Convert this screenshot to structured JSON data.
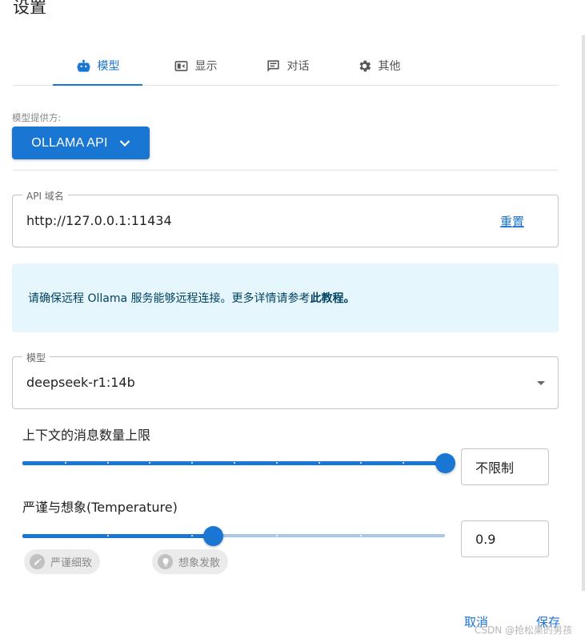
{
  "dialog": {
    "title": "设置"
  },
  "tabs": [
    {
      "label": "模型",
      "icon": "robot-icon",
      "active": true
    },
    {
      "label": "显示",
      "icon": "display-icon",
      "active": false
    },
    {
      "label": "对话",
      "icon": "chat-icon",
      "active": false
    },
    {
      "label": "其他",
      "icon": "gear-icon",
      "active": false
    }
  ],
  "provider": {
    "label": "模型提供方:",
    "value": "OLLAMA API"
  },
  "api_host": {
    "legend": "API 域名",
    "value": "http://127.0.0.1:11434",
    "reset_label": "重置"
  },
  "info": {
    "text": "请确保远程 Ollama 服务能够远程连接。更多详情请参考",
    "link_text": "此教程",
    "suffix": "。"
  },
  "model": {
    "legend": "模型",
    "value": "deepseek-r1:14b"
  },
  "context_limit": {
    "title": "上下文的消息数量上限",
    "value": "不限制",
    "level_fraction": 1.0,
    "marks": 11
  },
  "temperature": {
    "title": "严谨与想象(Temperature)",
    "value": "0.9",
    "level_fraction": 0.45,
    "marks": 6
  },
  "temperature_chips": {
    "strict": "严谨细致",
    "creative": "想象发散"
  },
  "footer": {
    "cancel_label": "取消",
    "save_label": "保存"
  },
  "watermark": "CSDN @抢松果的男孩",
  "colors": {
    "accent": "#1976d2",
    "info_bg": "#e5f6fd",
    "info_text": "#014361"
  }
}
